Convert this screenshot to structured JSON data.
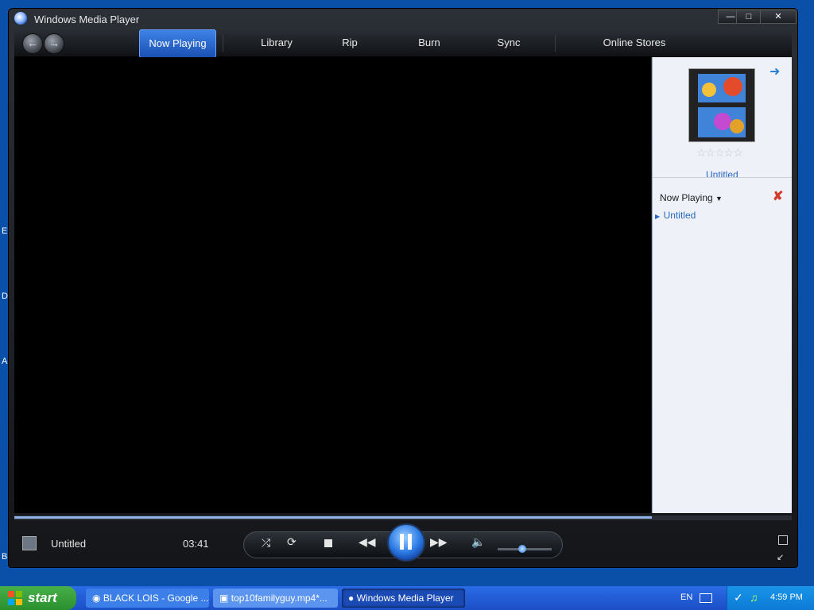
{
  "desktop": {
    "edge_letters": [
      "E",
      "D",
      "A",
      "Bl"
    ]
  },
  "window": {
    "title": "Windows Media Player",
    "caption_buttons": [
      "minimize",
      "maximize",
      "close"
    ]
  },
  "nav": {
    "tabs": [
      {
        "label": "Now Playing",
        "active": true
      },
      {
        "label": "Library"
      },
      {
        "label": "Rip"
      },
      {
        "label": "Burn"
      },
      {
        "label": "Sync"
      },
      {
        "label": "Online Stores"
      }
    ]
  },
  "panel": {
    "album_title": "Untitled",
    "list_header": "Now Playing",
    "items": [
      "Untitled"
    ]
  },
  "status": {
    "title": "Untitled",
    "time": "03:41"
  },
  "seek": {
    "progress": 0.82
  },
  "volume": {
    "level": 0.45
  },
  "icons": {
    "shuffle": "shuffle-icon",
    "repeat": "repeat-icon",
    "stop": "stop-icon",
    "prev": "rewind-icon",
    "play_pause": "pause-icon",
    "next": "fast-forward-icon",
    "mute": "speaker-icon"
  },
  "colors": {
    "accent": "#2a67c4",
    "taskbar": "#2a6be6",
    "start": "#3a9e3d"
  },
  "taskbar": {
    "start_label": "start",
    "tasks": [
      {
        "label": "BLACK LOIS - Google ..."
      },
      {
        "label": "top10familyguy.mp4*..."
      },
      {
        "label": "Windows Media Player"
      }
    ],
    "lang": "EN",
    "clock": "4:59 PM"
  }
}
